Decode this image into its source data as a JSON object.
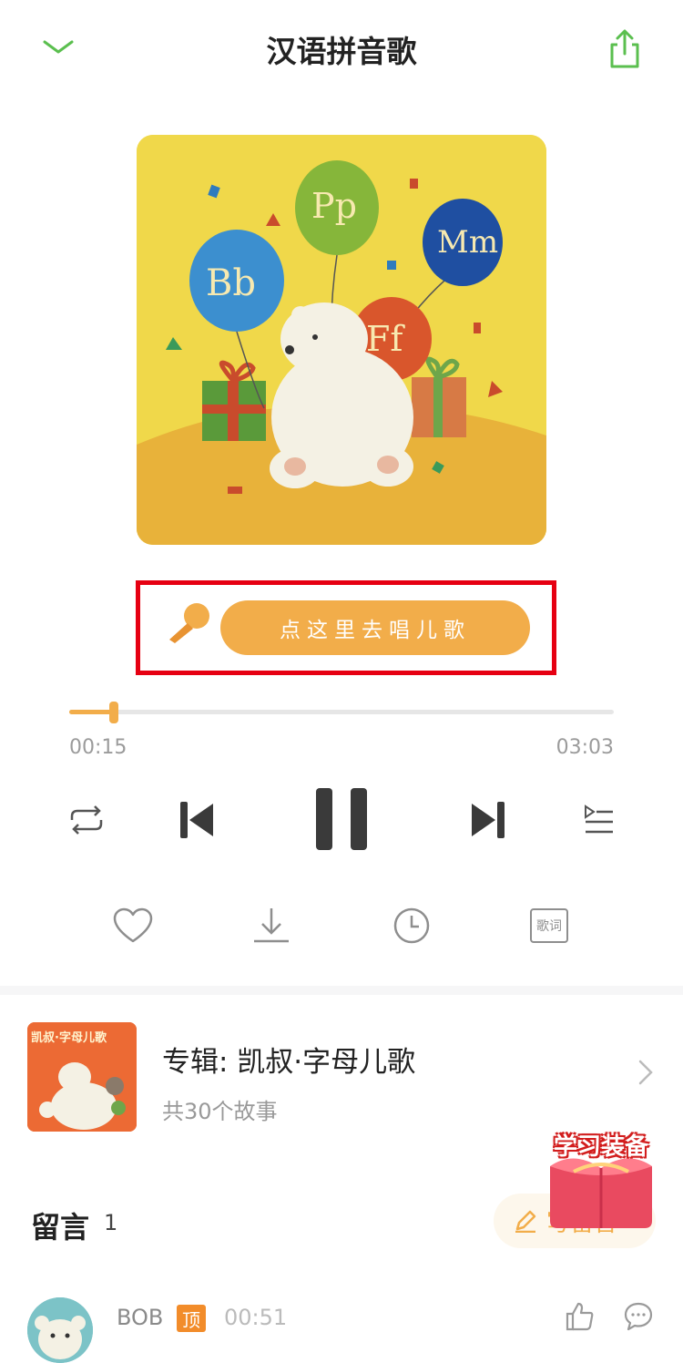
{
  "header": {
    "title": "汉语拼音歌",
    "collapse_icon": "chevron-down-icon",
    "share_icon": "share-icon",
    "accent_color": "#5bbf4f"
  },
  "cover": {
    "balloon_labels": [
      "Bb",
      "Pp",
      "Mm",
      "Ff"
    ]
  },
  "sing_button": {
    "label": "点这里去唱儿歌",
    "icon": "microphone-icon",
    "color": "#f2ad4a"
  },
  "player": {
    "elapsed": "00:15",
    "duration": "03:03",
    "progress_fraction": 0.082,
    "state": "playing",
    "controls": [
      "repeat-icon",
      "previous-icon",
      "pause-icon",
      "next-icon",
      "playlist-icon"
    ]
  },
  "actions": {
    "items": [
      "heart-icon",
      "download-icon",
      "clock-icon",
      "lyrics-icon"
    ],
    "lyrics_label": "歌词"
  },
  "album": {
    "title": "专辑: 凯叔·字母儿歌",
    "count": "共30个故事",
    "cover_text": "凯叔·字母儿歌"
  },
  "promo": {
    "label": "学习装备"
  },
  "comments": {
    "title": "留言",
    "count": "1",
    "write_label": "写留言",
    "items": [
      {
        "user": "BOB",
        "badge": "顶",
        "time": "00:51"
      }
    ]
  }
}
